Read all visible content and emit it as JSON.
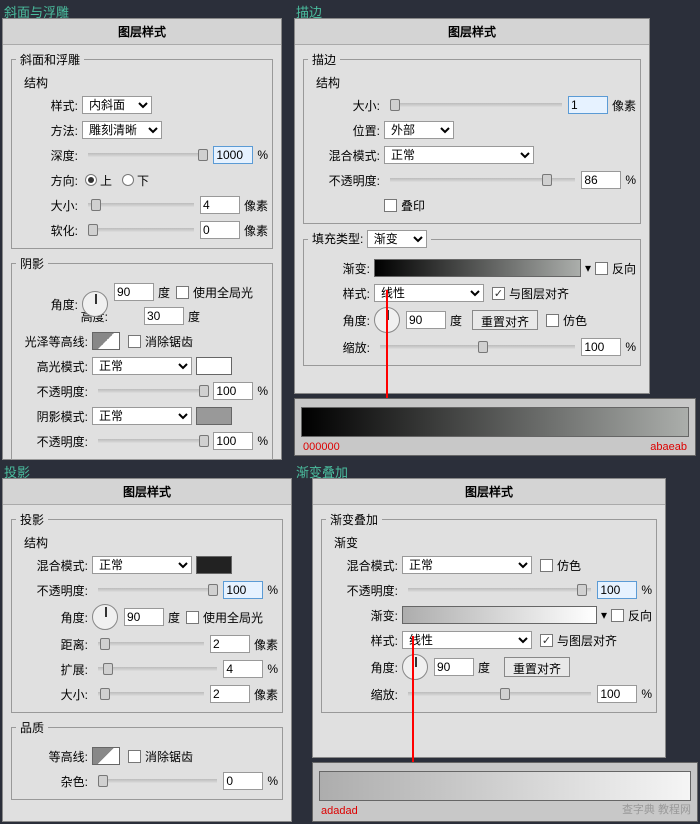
{
  "labels": {
    "bevel": "斜面与浮雕",
    "stroke": "描边",
    "shadow": "投影",
    "gradov": "渐变叠加"
  },
  "title": "图层样式",
  "bevel": {
    "g1": "斜面和浮雕",
    "g1b": "结构",
    "g2": "阴影",
    "style_l": "样式:",
    "style_v": "内斜面",
    "tech_l": "方法:",
    "tech_v": "雕刻清晰",
    "depth_l": "深度:",
    "depth_v": "1000",
    "pct": "%",
    "dir_l": "方向:",
    "up": "上",
    "down": "下",
    "size_l": "大小:",
    "size_v": "4",
    "px": "像素",
    "soft_l": "软化:",
    "soft_v": "0",
    "angle_l": "角度:",
    "angle_v": "90",
    "deg": "度",
    "global": "使用全局光",
    "alt_l": "高度:",
    "alt_v": "30",
    "gloss_l": "光泽等高线:",
    "aa": "消除锯齿",
    "hmode_l": "高光模式:",
    "hmode_v": "正常",
    "hop_l": "不透明度:",
    "hop_v": "100",
    "smode_l": "阴影模式:",
    "smode_v": "正常",
    "sop_v": "100"
  },
  "stroke": {
    "g1": "描边",
    "g1b": "结构",
    "g2": "填充类型:",
    "fill_v": "渐变",
    "size_l": "大小:",
    "size_v": "1",
    "px": "像素",
    "pos_l": "位置:",
    "pos_v": "外部",
    "blend_l": "混合模式:",
    "blend_v": "正常",
    "op_l": "不透明度:",
    "op_v": "86",
    "pct": "%",
    "overprint": "叠印",
    "grad_l": "渐变:",
    "rev": "反向",
    "style_l": "样式:",
    "style_v": "线性",
    "align": "与图层对齐",
    "angle_l": "角度:",
    "angle_v": "90",
    "deg": "度",
    "reset": "重置对齐",
    "dither": "仿色",
    "scale_l": "缩放:",
    "scale_v": "100",
    "stop1": "000000",
    "stop2": "abaeab"
  },
  "shadow": {
    "g1": "投影",
    "g1b": "结构",
    "g2": "品质",
    "blend_l": "混合模式:",
    "blend_v": "正常",
    "op_l": "不透明度:",
    "op_v": "100",
    "pct": "%",
    "angle_l": "角度:",
    "angle_v": "90",
    "deg": "度",
    "global": "使用全局光",
    "dist_l": "距离:",
    "dist_v": "2",
    "px": "像素",
    "spread_l": "扩展:",
    "spread_v": "4",
    "size_l": "大小:",
    "size_v": "2",
    "contour_l": "等高线:",
    "aa": "消除锯齿",
    "noise_l": "杂色:",
    "noise_v": "0"
  },
  "gradov": {
    "g1": "渐变叠加",
    "g1b": "渐变",
    "blend_l": "混合模式:",
    "blend_v": "正常",
    "dither": "仿色",
    "op_l": "不透明度:",
    "op_v": "100",
    "pct": "%",
    "grad_l": "渐变:",
    "rev": "反向",
    "style_l": "样式:",
    "style_v": "线性",
    "align": "与图层对齐",
    "angle_l": "角度:",
    "angle_v": "90",
    "deg": "度",
    "reset": "重置对齐",
    "scale_l": "缩放:",
    "scale_v": "100",
    "stop1": "adadad"
  },
  "watermark": "查字典 教程网",
  "chart_data": null
}
